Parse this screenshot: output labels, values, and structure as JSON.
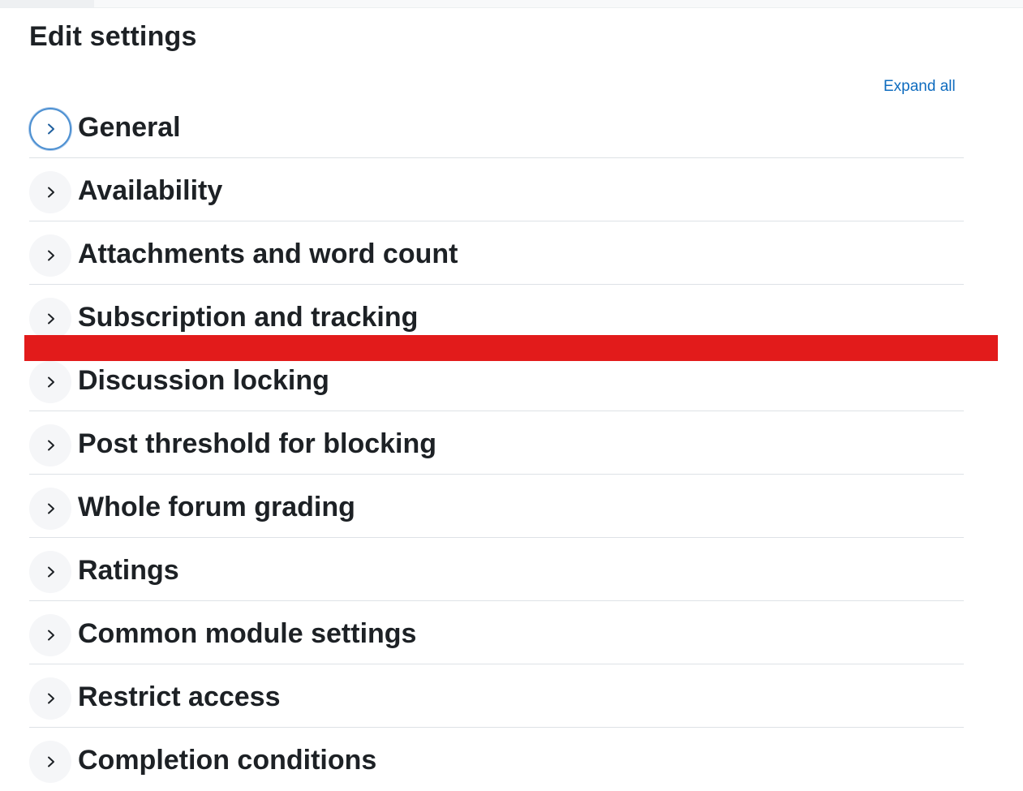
{
  "page": {
    "title": "Edit settings",
    "expand_all_label": "Expand all"
  },
  "colors": {
    "link": "#0f6cbf",
    "focus_ring": "#4b8fd1",
    "redaction_bar": "#e21b1b",
    "divider": "#dee2e6"
  },
  "sections": [
    {
      "label": "General",
      "icon": "chevron-right-icon",
      "focused": true
    },
    {
      "label": "Availability",
      "icon": "chevron-right-icon"
    },
    {
      "label": "Attachments and word count",
      "icon": "chevron-right-icon"
    },
    {
      "label": "Subscription and tracking",
      "icon": "chevron-right-icon"
    },
    {
      "label": "Discussion locking",
      "icon": "chevron-right-icon"
    },
    {
      "label": "Post threshold for blocking",
      "icon": "chevron-right-icon"
    },
    {
      "label": "Whole forum grading",
      "icon": "chevron-right-icon"
    },
    {
      "label": "Ratings",
      "icon": "chevron-right-icon"
    },
    {
      "label": "Common module settings",
      "icon": "chevron-right-icon"
    },
    {
      "label": "Restrict access",
      "icon": "chevron-right-icon"
    },
    {
      "label": "Completion conditions",
      "icon": "chevron-right-icon"
    }
  ]
}
